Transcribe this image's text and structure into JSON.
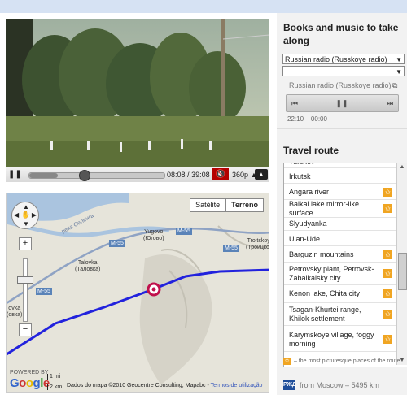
{
  "video": {
    "current_time": "08:08",
    "duration": "39:08",
    "time_separator": "/",
    "quality": "360p",
    "progress": 0.21,
    "play_pause_icon": "pause-icon",
    "mute_icon": "volume-muted-icon"
  },
  "map": {
    "type_buttons": [
      "Satélite",
      "Terreno"
    ],
    "active_type": "Terreno",
    "places": [
      {
        "name": "Yugovo",
        "alt": "(Югово)"
      },
      {
        "name": "Talovka",
        "alt": "(Таловка)"
      },
      {
        "name": "Troitskoye",
        "alt": "(Троицкое)"
      },
      {
        "name": "ovka",
        "alt": "(овка)"
      }
    ],
    "road_labels": [
      "M-55",
      "M-55",
      "M-55",
      "M-55"
    ],
    "river_label": "река Селенга",
    "scale_mi": "1 mi",
    "scale_km": "2 km",
    "powered_by": "POWERED BY",
    "logo_text": "Google",
    "attribution": "Dados do mapa ©2010 Geocentre Consulting, Mapabc - ",
    "terms_link": "Termos de utilização"
  },
  "sidebar": {
    "books_title": "Books and music to take along",
    "radio_select_value": "Russian radio (Russkoye radio)",
    "second_select_value": "",
    "player_link": "Russian radio (Russkoye radio)",
    "audio_time_current": "22:10",
    "audio_time_total": "00:00",
    "travel_title": "Travel route",
    "route_items": [
      {
        "label": "Tulunov",
        "star": false
      },
      {
        "label": "Irkutsk",
        "star": false
      },
      {
        "label": "Angara river",
        "star": true
      },
      {
        "label": "Baikal lake mirror-like surface",
        "star": true
      },
      {
        "label": "Slyudyanka",
        "star": false
      },
      {
        "label": "Ulan-Ude",
        "star": false
      },
      {
        "label": "Barguzin mountains",
        "star": true
      },
      {
        "label": "Petrovsky plant, Petrovsk-Zabaikalsky city",
        "star": true
      },
      {
        "label": "Kenon lake, Chita city",
        "star": true
      },
      {
        "label": "Tsagan-Khurtei range, Khilok settlement",
        "star": true
      },
      {
        "label": "Karymskoye village, foggy morning",
        "star": true
      }
    ],
    "legend_text": "– the most picturesque places of the route",
    "from_text": "from Moscow –",
    "distance": "5495 km",
    "rzd_logo": "РЖД"
  }
}
